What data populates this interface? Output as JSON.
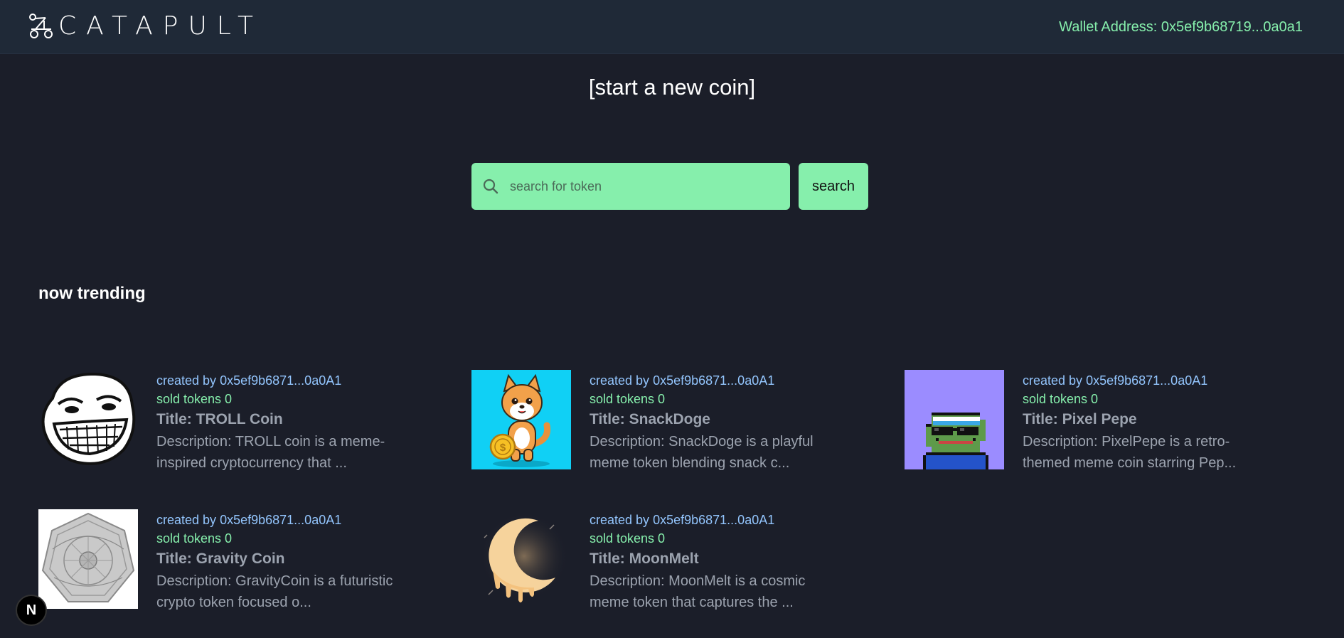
{
  "header": {
    "logo_text": "CATAPULT",
    "wallet_label": "Wallet Address:",
    "wallet_address": "0x5ef9b68719...0a0a1"
  },
  "main": {
    "start_link": "[start a new coin]",
    "search": {
      "placeholder": "search for token",
      "value": "",
      "button_label": "search"
    },
    "trending_heading": "now trending"
  },
  "coins": [
    {
      "creator_label": "created by",
      "creator": "0x5ef9b6871...0a0A1",
      "sold": "sold tokens 0",
      "title": "Title: TROLL Coin",
      "desc_line1": "Description: TROLL coin is a meme-",
      "desc_line2": "inspired cryptocurrency that ...",
      "image": "troll-face"
    },
    {
      "creator_label": "created by",
      "creator": "0x5ef9b6871...0a0A1",
      "sold": "sold tokens 0",
      "title": "Title: SnackDoge",
      "desc_line1": "Description: SnackDoge is a playful",
      "desc_line2": "meme token blending snack c...",
      "image": "shiba-with-coin"
    },
    {
      "creator_label": "created by",
      "creator": "0x5ef9b6871...0a0A1",
      "sold": "sold tokens 0",
      "title": "Title: Pixel Pepe",
      "desc_line1": "Description: PixelPepe is a retro-",
      "desc_line2": "themed meme coin starring Pep...",
      "image": "pixel-frog"
    },
    {
      "creator_label": "created by",
      "creator": "0x5ef9b6871...0a0A1",
      "sold": "sold tokens 0",
      "title": "Title: Gravity Coin",
      "desc_line1": "Description: GravityCoin is a futuristic",
      "desc_line2": "crypto token focused o...",
      "image": "silver-coin"
    },
    {
      "creator_label": "created by",
      "creator": "0x5ef9b6871...0a0A1",
      "sold": "sold tokens 0",
      "title": "Title: MoonMelt",
      "desc_line1": "Description: MoonMelt is a cosmic",
      "desc_line2": "meme token that captures the ...",
      "image": "melting-moon"
    }
  ],
  "badge": {
    "label": "N"
  },
  "colors": {
    "background": "#1b1e29",
    "topbar": "#1f2937",
    "accent_green": "#86efac",
    "creator_blue": "#93c5fd",
    "muted_text": "#9ca3af"
  }
}
